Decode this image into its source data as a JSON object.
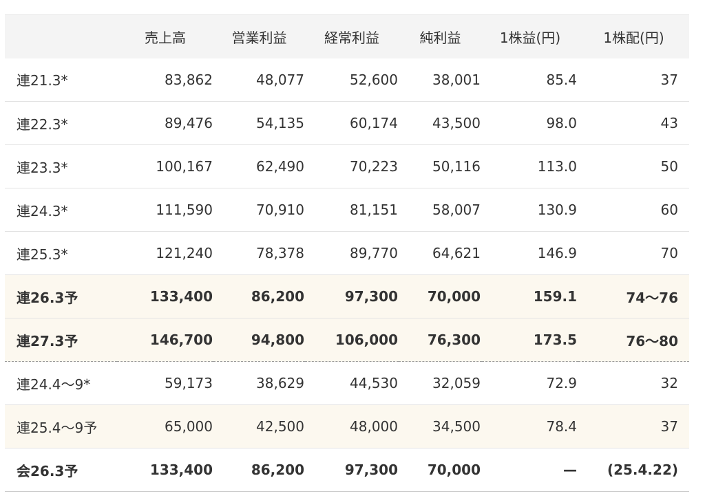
{
  "table": {
    "headers": [
      "",
      "売上高",
      "営業利益",
      "経常利益",
      "純利益",
      "1株益(円)",
      "1株配(円)"
    ],
    "rows": [
      {
        "label": "連21.3*",
        "cells": [
          "83,862",
          "48,077",
          "52,600",
          "38,001",
          "85.4",
          "37"
        ]
      },
      {
        "label": "連22.3*",
        "cells": [
          "89,476",
          "54,135",
          "60,174",
          "43,500",
          "98.0",
          "43"
        ]
      },
      {
        "label": "連23.3*",
        "cells": [
          "100,167",
          "62,490",
          "70,223",
          "50,116",
          "113.0",
          "50"
        ]
      },
      {
        "label": "連24.3*",
        "cells": [
          "111,590",
          "70,910",
          "81,151",
          "58,007",
          "130.9",
          "60"
        ]
      },
      {
        "label": "連25.3*",
        "cells": [
          "121,240",
          "78,378",
          "89,770",
          "64,621",
          "146.9",
          "70"
        ]
      },
      {
        "label": "連26.3予",
        "cells": [
          "133,400",
          "86,200",
          "97,300",
          "70,000",
          "159.1",
          "74〜76"
        ]
      },
      {
        "label": "連27.3予",
        "cells": [
          "146,700",
          "94,800",
          "106,000",
          "76,300",
          "173.5",
          "76〜80"
        ]
      },
      {
        "label": "連24.4〜9*",
        "cells": [
          "59,173",
          "38,629",
          "44,530",
          "32,059",
          "72.9",
          "32"
        ]
      },
      {
        "label": "連25.4〜9予",
        "cells": [
          "65,000",
          "42,500",
          "48,000",
          "34,500",
          "78.4",
          "37"
        ]
      },
      {
        "label": "会26.3予",
        "cells": [
          "133,400",
          "86,200",
          "97,300",
          "70,000",
          "—",
          "(25.4.22)"
        ]
      }
    ]
  }
}
